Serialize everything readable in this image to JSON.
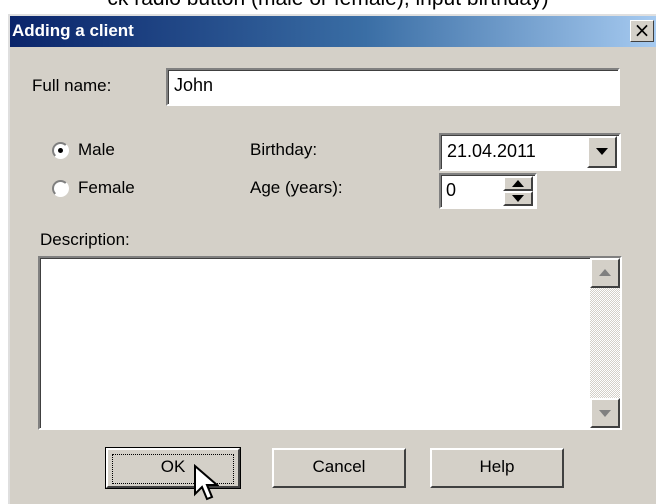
{
  "document": {
    "instruction_line": "ck radio button (male or female), input birthday)"
  },
  "dialog": {
    "title": "Adding a client",
    "close_glyph": "×"
  },
  "form": {
    "full_name_label": "Full name:",
    "full_name_value": "John",
    "gender": {
      "options": [
        "Male",
        "Female"
      ],
      "selected": "Male"
    },
    "birthday_label": "Birthday:",
    "birthday_value": "21.04.2011",
    "age_label": "Age (years):",
    "age_value": "0",
    "description_label": "Description:",
    "description_value": ""
  },
  "buttons": {
    "ok": "OK",
    "cancel": "Cancel",
    "help": "Help"
  },
  "icons": {
    "close": "close-icon",
    "dropdown": "chevron-down-icon",
    "spin_up": "chevron-up-icon",
    "spin_down": "chevron-down-icon",
    "scroll_up": "arrow-up-icon",
    "scroll_down": "arrow-down-icon",
    "cursor": "mouse-pointer-icon"
  },
  "colors": {
    "dialog_face": "#d4d0c8",
    "title_start": "#0a246a",
    "title_end": "#a6caf0",
    "title_text": "#ffffff"
  }
}
